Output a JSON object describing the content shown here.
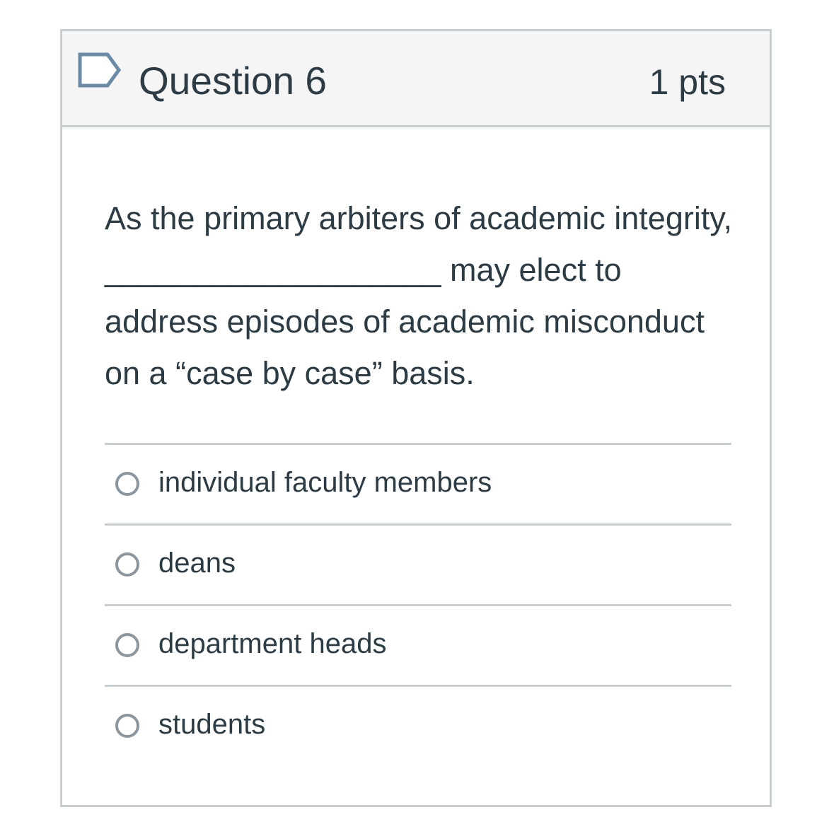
{
  "question": {
    "flag_icon": "bookmark-flag-icon",
    "title": "Question 6",
    "points": "1 pts",
    "text": "As the primary arbiters of academic integrity, ___________________ may elect to address episodes of academic misconduct on a “case by case” basis."
  },
  "answers": [
    {
      "label": "individual faculty members",
      "selected": false
    },
    {
      "label": "deans",
      "selected": false
    },
    {
      "label": "department heads",
      "selected": false
    },
    {
      "label": "students",
      "selected": false
    }
  ],
  "colors": {
    "text": "#2d3b45",
    "header_bg": "#f5f5f5",
    "border": "#c7cdd1",
    "flag": "#6a8aa6",
    "radio_border": "#8b969e"
  }
}
